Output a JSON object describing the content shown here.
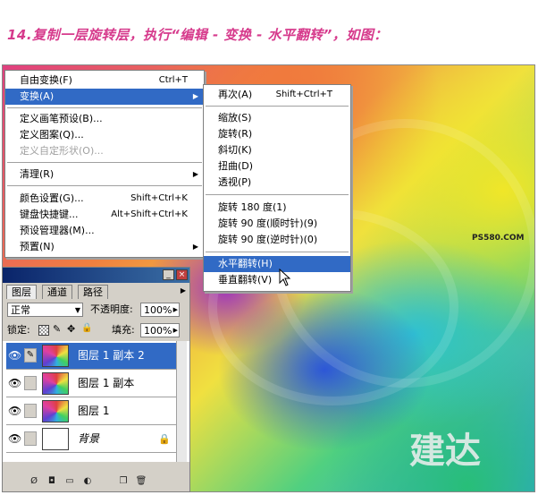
{
  "caption": "14.复制一层旋转层，执行“编辑 - 变换 - 水平翻转”，如图：",
  "edit_menu": {
    "items": [
      {
        "label": "自由变换(F)",
        "shortcut": "Ctrl+T"
      },
      {
        "label": "变换(A)",
        "arrow": "▶"
      },
      {
        "label": "定义画笔预设(B)..."
      },
      {
        "label": "定义图案(Q)..."
      },
      {
        "label": "定义自定形状(O)..."
      },
      {
        "label": "清理(R)",
        "arrow": "▶"
      },
      {
        "label": "颜色设置(G)...",
        "shortcut": "Shift+Ctrl+K"
      },
      {
        "label": "键盘快捷键...",
        "shortcut": "Alt+Shift+Ctrl+K"
      },
      {
        "label": "预设管理器(M)..."
      },
      {
        "label": "预置(N)",
        "arrow": "▶"
      }
    ]
  },
  "transform_menu": {
    "items": [
      {
        "label": "再次(A)",
        "shortcut": "Shift+Ctrl+T"
      },
      {
        "label": "缩放(S)"
      },
      {
        "label": "旋转(R)"
      },
      {
        "label": "斜切(K)"
      },
      {
        "label": "扭曲(D)"
      },
      {
        "label": "透视(P)"
      },
      {
        "label": "旋转 180 度(1)"
      },
      {
        "label": "旋转 90 度(顺时针)(9)"
      },
      {
        "label": "旋转 90 度(逆时针)(0)"
      },
      {
        "label": "水平翻转(H)"
      },
      {
        "label": "垂直翻转(V)"
      }
    ]
  },
  "layers_panel": {
    "tabs": [
      "图层",
      "通道",
      "路径"
    ],
    "blend_mode": "正常",
    "opacity_label": "不透明度:",
    "opacity_value": "100%",
    "lock_label": "锁定:",
    "fill_label": "填充:",
    "fill_value": "100%",
    "layers": [
      {
        "name": "图层 1 副本 2",
        "selected": true
      },
      {
        "name": "图层 1 副本"
      },
      {
        "name": "图层 1"
      },
      {
        "name": "背景",
        "locked": true
      }
    ]
  },
  "watermarks": {
    "site": "PS580.COM",
    "logo": "建达"
  }
}
